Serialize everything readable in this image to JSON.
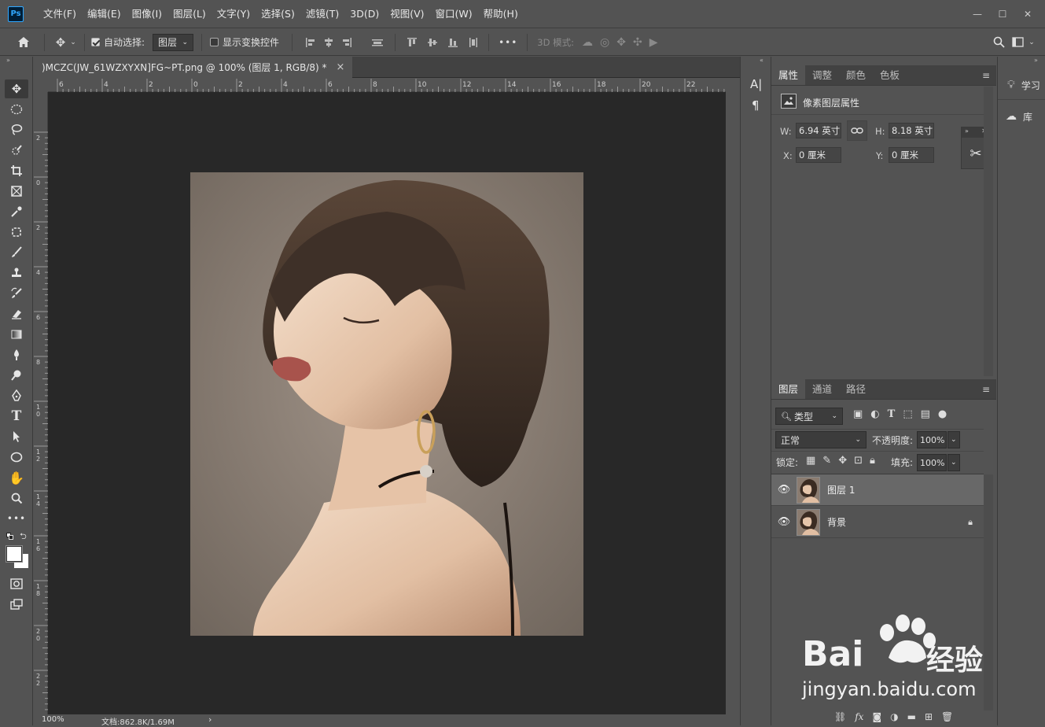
{
  "menubar": {
    "logo": "Ps",
    "items": [
      "文件(F)",
      "编辑(E)",
      "图像(I)",
      "图层(L)",
      "文字(Y)",
      "选择(S)",
      "滤镜(T)",
      "3D(D)",
      "视图(V)",
      "窗口(W)",
      "帮助(H)"
    ],
    "window_controls": {
      "minimize": "—",
      "restore": "☐",
      "close": "✕"
    }
  },
  "options": {
    "auto_select_label": "自动选择:",
    "auto_select_checked": true,
    "auto_select_target": "图层",
    "show_transform_label": "显示变换控件",
    "show_transform_checked": false,
    "more": "•••",
    "mode3d_label": "3D 模式:"
  },
  "document": {
    "tab_title": ")MCZC(JW_61WZXYXN]FG~PT.png @ 100% (图层 1, RGB/8) *",
    "tab_close": "×",
    "ruler_top_labels": [
      "6",
      "4",
      "2",
      "0",
      "2",
      "4",
      "6",
      "8",
      "10",
      "12",
      "14",
      "16",
      "18",
      "20",
      "22"
    ],
    "ruler_left_labels": [
      "2",
      "0",
      "2",
      "4",
      "6",
      "8",
      "10",
      "12",
      "14",
      "16",
      "18",
      "20",
      "22",
      "24"
    ],
    "zoom": "100%",
    "doc_info": "文档:862.8K/1.69M",
    "status_arrow": "›"
  },
  "midstrip": {
    "char_icon": "A|",
    "para_icon": "¶"
  },
  "properties": {
    "tabs": [
      "属性",
      "调整",
      "颜色",
      "色板"
    ],
    "active_tab": 0,
    "section_title": "像素图层属性",
    "w_label": "W:",
    "w_value": "6.94 英寸",
    "h_label": "H:",
    "h_value": "8.18 英寸",
    "x_label": "X:",
    "x_value": "0 厘米",
    "y_label": "Y:",
    "y_value": "0 厘米"
  },
  "layers": {
    "tabs": [
      "图层",
      "通道",
      "路径"
    ],
    "active_tab": 0,
    "filter_label": "类型",
    "blend_mode": "正常",
    "opacity_label": "不透明度:",
    "opacity_value": "100%",
    "lock_label": "锁定:",
    "fill_label": "填充:",
    "fill_value": "100%",
    "items": [
      {
        "name": "图层 1",
        "selected": true,
        "locked": false
      },
      {
        "name": "背景",
        "selected": false,
        "locked": true
      }
    ],
    "footer_fx": "fx"
  },
  "farright": {
    "learn_label": "学习",
    "library_label": "库"
  },
  "watermark": {
    "brand": "Bai",
    "brand_cn": "经验",
    "url": "jingyan.baidu.com"
  },
  "colors": {
    "ui_bg": "#535353",
    "canvas_bg": "#282828",
    "accent": "#31a8ff"
  }
}
